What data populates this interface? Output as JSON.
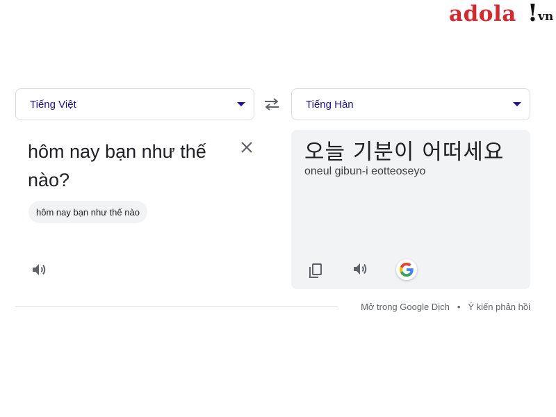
{
  "watermark": {
    "brand": "adola",
    "bang": "!",
    "tld": "vn"
  },
  "source": {
    "language": "Tiếng Việt",
    "text": "hôm nay bạn như thế nào?",
    "suggestion": "hôm nay bạn như thế nào"
  },
  "target": {
    "language": "Tiếng Hàn",
    "text": "오늘 기분이 어떠세요",
    "romanization": "oneul gibun-i eotteoseyo"
  },
  "icons": {
    "swap": "swap-languages-icon",
    "clear": "close-icon",
    "speaker": "speaker-icon",
    "copy": "copy-icon",
    "google": "google-logo-icon"
  },
  "footer": {
    "open_link": "Mở trong Google Dịch",
    "separator": "•",
    "feedback_link": "Ý kiến phản hồi"
  },
  "colors": {
    "language_label": "#1a0dab",
    "watermark_red": "#d9272e",
    "panel_bg": "#f1f3f4"
  }
}
